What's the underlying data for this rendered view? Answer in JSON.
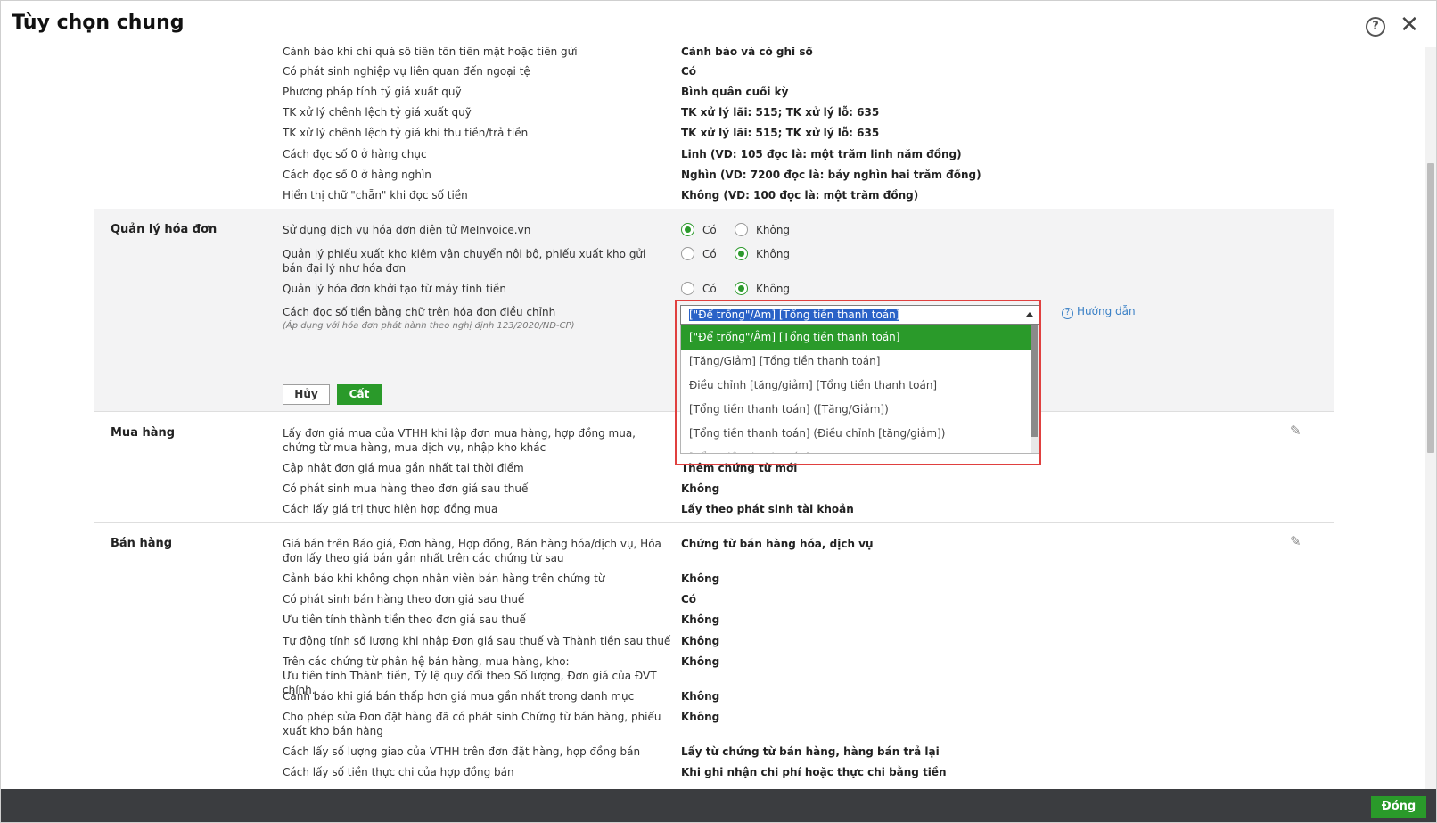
{
  "window": {
    "title": "Tùy chọn chung",
    "help_glyph": "?",
    "close_glyph": "✕"
  },
  "top_section": {
    "rows": [
      {
        "label": "Cảnh báo khi chi quá số tiền tồn tiền mặt hoặc tiền gửi",
        "value": "Cảnh báo và có ghi sổ"
      },
      {
        "label": "Có phát sinh nghiệp vụ liên quan đến ngoại tệ",
        "value": "Có"
      },
      {
        "label": "Phương pháp tính tỷ giá xuất quỹ",
        "value": "Bình quân cuối kỳ"
      },
      {
        "label": "TK xử lý chênh lệch tỷ giá xuất quỹ",
        "value": "TK xử lý lãi: 515; TK xử lý lỗ: 635"
      },
      {
        "label": "TK xử lý chênh lệch tỷ giá khi thu tiền/trả tiền",
        "value": "TK xử lý lãi: 515; TK xử lý lỗ: 635"
      },
      {
        "label": "Cách đọc số 0 ở hàng chục",
        "value": "Linh (VD: 105 đọc là: một trăm linh năm đồng)"
      },
      {
        "label": "Cách đọc số 0 ở hàng nghìn",
        "value": "Nghìn (VD: 7200 đọc là: bảy nghìn hai trăm đồng)"
      },
      {
        "label": "Hiển thị chữ \"chẵn\" khi đọc số tiền",
        "value": "Không (VD: 100 đọc là: một trăm đồng)"
      }
    ]
  },
  "invoice_section": {
    "title": "Quản lý hóa đơn",
    "option_yes": "Có",
    "option_no": "Không",
    "rows": [
      {
        "label": "Sử dụng dịch vụ hóa đơn điện tử MeInvoice.vn",
        "selected": "yes"
      },
      {
        "label": "Quản lý phiếu xuất kho kiêm vận chuyển nội bộ, phiếu xuất kho gửi bán đại lý như hóa đơn",
        "selected": "no"
      },
      {
        "label": "Quản lý hóa đơn khởi tạo từ máy tính tiền",
        "selected": "no"
      }
    ],
    "adjust_label": "Cách đọc số tiền bằng chữ trên hóa đơn điều chỉnh",
    "adjust_note": "(Áp dụng với hóa đơn phát hành theo nghị định 123/2020/NĐ-CP)",
    "dropdown": {
      "value": "[\"Để trống\"/Âm] [Tổng tiền thanh toán]",
      "options": [
        "[\"Để trống\"/Âm] [Tổng tiền thanh toán]",
        "[Tăng/Giảm] [Tổng tiền thanh toán]",
        "Điều chỉnh [tăng/giảm] [Tổng tiền thanh toán]",
        "[Tổng tiền thanh toán] ([Tăng/Giảm])",
        "[Tổng tiền thanh toán] (Điều chỉnh [tăng/giảm])",
        "[Tổng tiền thanh toán]"
      ]
    },
    "help_link": "Hướng dẫn",
    "cancel_label": "Hủy",
    "save_label": "Cất"
  },
  "purchase_section": {
    "title": "Mua hàng",
    "rows": [
      {
        "label": "Lấy đơn giá mua của VTHH khi lập đơn mua hàng, hợp đồng mua, chứng từ mua hàng, mua dịch vụ, nhập kho khác",
        "value": ""
      },
      {
        "label": "Cập nhật đơn giá mua gần nhất tại thời điểm",
        "value": "Thêm chứng từ mới"
      },
      {
        "label": "Có phát sinh mua hàng theo đơn giá sau thuế",
        "value": "Không"
      },
      {
        "label": "Cách lấy giá trị thực hiện hợp đồng mua",
        "value": "Lấy theo phát sinh tài khoản"
      }
    ]
  },
  "sales_section": {
    "title": "Bán hàng",
    "rows": [
      {
        "label": "Giá bán trên Báo giá, Đơn hàng, Hợp đồng, Bán hàng hóa/dịch vụ, Hóa đơn lấy theo giá bán gần nhất trên các chứng từ sau",
        "value": "Chứng từ bán hàng hóa, dịch vụ"
      },
      {
        "label": "Cảnh báo khi không chọn nhân viên bán hàng trên chứng từ",
        "value": "Không"
      },
      {
        "label": "Có phát sinh bán hàng theo đơn giá sau thuế",
        "value": "Có"
      },
      {
        "label": "Ưu tiên tính thành tiền theo đơn giá sau thuế",
        "value": "Không"
      },
      {
        "label": "Tự động tính số lượng khi nhập Đơn giá sau thuế và Thành tiền sau thuế",
        "value": "Không"
      },
      {
        "label": "Trên các chứng từ phân hệ bán hàng, mua hàng, kho:",
        "label2": "Ưu tiên tính Thành tiền, Tỷ lệ quy đổi theo Số lượng, Đơn giá của ĐVT chính.",
        "value": "Không"
      },
      {
        "label": "Cảnh báo khi giá bán thấp hơn giá mua gần nhất trong danh mục",
        "value": "Không"
      },
      {
        "label": "Cho phép sửa Đơn đặt hàng đã có phát sinh Chứng từ bán hàng, phiếu xuất kho bán hàng",
        "value": "Không"
      },
      {
        "label": "Cách lấy số lượng giao của VTHH trên đơn đặt hàng, hợp đồng bán",
        "value": "Lấy từ chứng từ bán hàng, hàng bán trả lại"
      },
      {
        "label": "Cách lấy số tiền thực chi của hợp đồng bán",
        "value": "Khi ghi nhận chi phí hoặc thực chi bằng tiền"
      }
    ]
  },
  "footer": {
    "close_label": "Đóng"
  },
  "icons": {
    "pencil": "✎",
    "question": "?"
  }
}
